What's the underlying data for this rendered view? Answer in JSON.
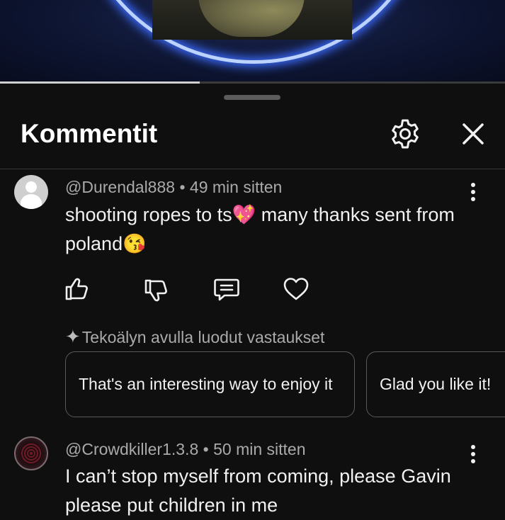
{
  "player": {
    "progress_fraction": 0.395
  },
  "sheet": {
    "title": "Kommentit",
    "settings_icon": "gear-icon",
    "close_icon": "close-icon"
  },
  "comments": [
    {
      "author": "@Durendal888",
      "separator": " • ",
      "time": "49 min sitten",
      "text": "shooting ropes to ts💖 many thanks sent from poland😘",
      "avatar": "default-avatar",
      "actions": [
        "like-icon",
        "dislike-icon",
        "reply-icon",
        "heart-icon"
      ],
      "ai_replies_label": "Tekoälyn avulla luodut vastaukset",
      "ai_replies": [
        "That's an interesting way to enjoy it",
        "Glad you like it!"
      ]
    },
    {
      "author": "@Crowdkiller1.3.8",
      "separator": " • ",
      "time": "50 min sitten",
      "text": "I can’t stop myself from coming, please Gavin please put children in me",
      "avatar": "profile-avatar"
    }
  ],
  "colors": {
    "background": "#0f0f0f",
    "text_primary": "#f1f1f1",
    "text_secondary": "#aaaaaa",
    "chip_border": "#5a5a5a"
  }
}
